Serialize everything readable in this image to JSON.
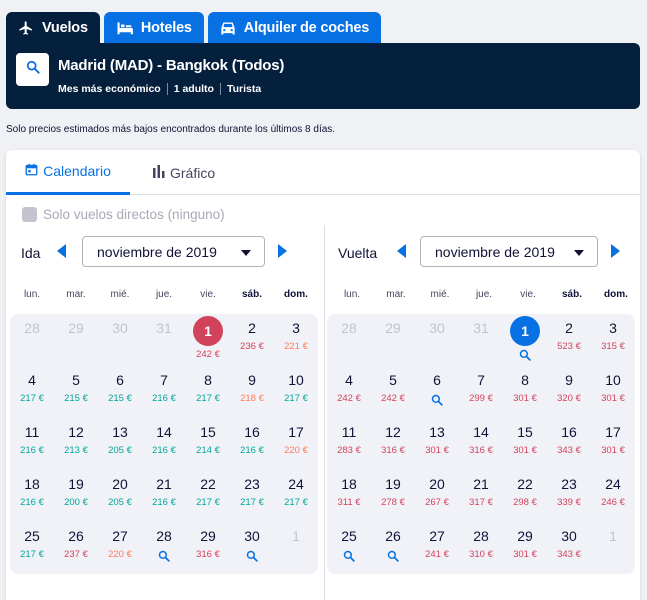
{
  "tabs": [
    {
      "label": "Vuelos",
      "icon": "plane-icon",
      "active": true
    },
    {
      "label": "Hoteles",
      "icon": "bed-icon",
      "active": false
    },
    {
      "label": "Alquiler de coches",
      "icon": "car-icon",
      "active": false
    }
  ],
  "search": {
    "route": "Madrid (MAD) - Bangkok (Todos)",
    "period": "Mes más económico",
    "passengers": "1 adulto",
    "cabin": "Turista"
  },
  "note": "Solo precios estimados más bajos encontrados durante los últimos 8 días.",
  "view_tabs": {
    "calendar": "Calendario",
    "graph": "Gráfico"
  },
  "direct_only": "Solo vuelos directos (ninguno)",
  "weekdays": [
    "lun.",
    "mar.",
    "mié.",
    "jue.",
    "vie.",
    "sáb.",
    "dom."
  ],
  "colors": {
    "cheap": "#00a698",
    "mid": "#ff7b59",
    "expensive": "#d1435b",
    "accent": "#0770e3",
    "navy": "#05203c"
  },
  "outbound": {
    "label": "Ida",
    "month": "noviembre de 2019",
    "cells": [
      {
        "d": "28",
        "muted": true
      },
      {
        "d": "29",
        "muted": true
      },
      {
        "d": "30",
        "muted": true
      },
      {
        "d": "31",
        "muted": true
      },
      {
        "d": "1",
        "p": "242 €",
        "c": "red",
        "sel": true
      },
      {
        "d": "2",
        "p": "236 €",
        "c": "red"
      },
      {
        "d": "3",
        "p": "221 €",
        "c": "orange"
      },
      {
        "d": "4",
        "p": "217 €",
        "c": "green"
      },
      {
        "d": "5",
        "p": "215 €",
        "c": "green"
      },
      {
        "d": "6",
        "p": "215 €",
        "c": "green"
      },
      {
        "d": "7",
        "p": "216 €",
        "c": "green"
      },
      {
        "d": "8",
        "p": "217 €",
        "c": "green"
      },
      {
        "d": "9",
        "p": "218 €",
        "c": "orange"
      },
      {
        "d": "10",
        "p": "217 €",
        "c": "green"
      },
      {
        "d": "11",
        "p": "216 €",
        "c": "green"
      },
      {
        "d": "12",
        "p": "213 €",
        "c": "green"
      },
      {
        "d": "13",
        "p": "205 €",
        "c": "green"
      },
      {
        "d": "14",
        "p": "216 €",
        "c": "green"
      },
      {
        "d": "15",
        "p": "214 €",
        "c": "green"
      },
      {
        "d": "16",
        "p": "216 €",
        "c": "green"
      },
      {
        "d": "17",
        "p": "220 €",
        "c": "orange"
      },
      {
        "d": "18",
        "p": "216 €",
        "c": "green"
      },
      {
        "d": "19",
        "p": "200 €",
        "c": "green"
      },
      {
        "d": "20",
        "p": "205 €",
        "c": "green"
      },
      {
        "d": "21",
        "p": "216 €",
        "c": "green"
      },
      {
        "d": "22",
        "p": "217 €",
        "c": "green"
      },
      {
        "d": "23",
        "p": "217 €",
        "c": "green"
      },
      {
        "d": "24",
        "p": "217 €",
        "c": "green"
      },
      {
        "d": "25",
        "p": "217 €",
        "c": "green"
      },
      {
        "d": "26",
        "p": "237 €",
        "c": "red"
      },
      {
        "d": "27",
        "p": "220 €",
        "c": "orange"
      },
      {
        "d": "28",
        "search": true
      },
      {
        "d": "29",
        "p": "316 €",
        "c": "red"
      },
      {
        "d": "30",
        "search": true
      },
      {
        "d": "1",
        "muted": true
      }
    ]
  },
  "return": {
    "label": "Vuelta",
    "month": "noviembre de 2019",
    "cells": [
      {
        "d": "28",
        "muted": true
      },
      {
        "d": "29",
        "muted": true
      },
      {
        "d": "30",
        "muted": true
      },
      {
        "d": "31",
        "muted": true
      },
      {
        "d": "1",
        "search": true,
        "sel": true
      },
      {
        "d": "2",
        "p": "523 €",
        "c": "red"
      },
      {
        "d": "3",
        "p": "315 €",
        "c": "red"
      },
      {
        "d": "4",
        "p": "242 €",
        "c": "red"
      },
      {
        "d": "5",
        "p": "242 €",
        "c": "red"
      },
      {
        "d": "6",
        "search": true
      },
      {
        "d": "7",
        "p": "299 €",
        "c": "red"
      },
      {
        "d": "8",
        "p": "301 €",
        "c": "red"
      },
      {
        "d": "9",
        "p": "320 €",
        "c": "red"
      },
      {
        "d": "10",
        "p": "301 €",
        "c": "red"
      },
      {
        "d": "11",
        "p": "283 €",
        "c": "red"
      },
      {
        "d": "12",
        "p": "316 €",
        "c": "red"
      },
      {
        "d": "13",
        "p": "301 €",
        "c": "red"
      },
      {
        "d": "14",
        "p": "316 €",
        "c": "red"
      },
      {
        "d": "15",
        "p": "301 €",
        "c": "red"
      },
      {
        "d": "16",
        "p": "343 €",
        "c": "red"
      },
      {
        "d": "17",
        "p": "301 €",
        "c": "red"
      },
      {
        "d": "18",
        "p": "311 €",
        "c": "red"
      },
      {
        "d": "19",
        "p": "278 €",
        "c": "red"
      },
      {
        "d": "20",
        "p": "267 €",
        "c": "red"
      },
      {
        "d": "21",
        "p": "317 €",
        "c": "red"
      },
      {
        "d": "22",
        "p": "298 €",
        "c": "red"
      },
      {
        "d": "23",
        "p": "339 €",
        "c": "red"
      },
      {
        "d": "24",
        "p": "246 €",
        "c": "red"
      },
      {
        "d": "25",
        "search": true
      },
      {
        "d": "26",
        "search": true
      },
      {
        "d": "27",
        "p": "241 €",
        "c": "red"
      },
      {
        "d": "28",
        "p": "310 €",
        "c": "red"
      },
      {
        "d": "29",
        "p": "301 €",
        "c": "red"
      },
      {
        "d": "30",
        "p": "343 €",
        "c": "red"
      },
      {
        "d": "1",
        "muted": true
      }
    ]
  }
}
